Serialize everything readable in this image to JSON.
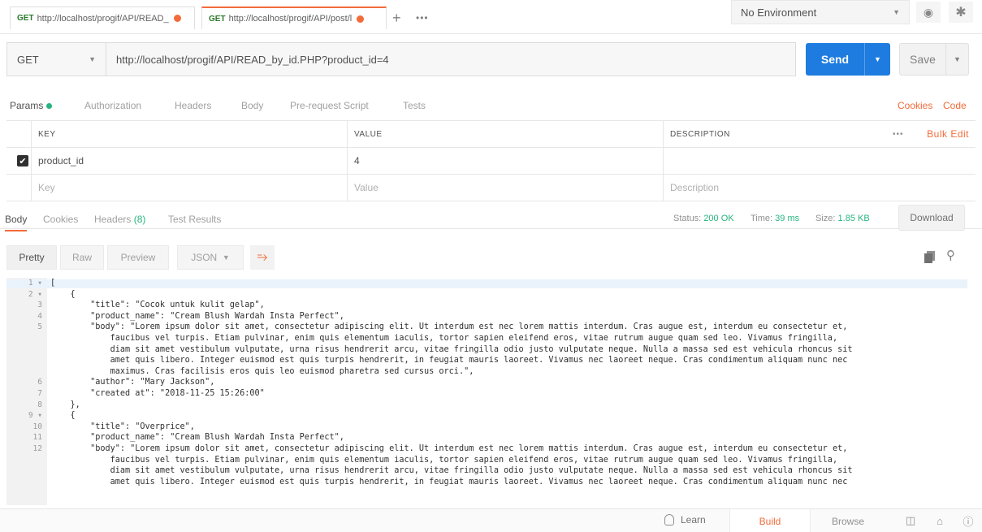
{
  "tabs": [
    {
      "method": "GET",
      "url": "http://localhost/progif/API/READ_"
    },
    {
      "method": "GET",
      "url": "http://localhost/progif/API/post/l"
    }
  ],
  "tabbar": {
    "plus": "+",
    "more": "•••"
  },
  "environment": {
    "selected": "No Environment"
  },
  "request": {
    "method": "GET",
    "url": "http://localhost/progif/API/READ_by_id.PHP?product_id=4",
    "send_label": "Send",
    "save_label": "Save"
  },
  "request_tabs": [
    "Params",
    "Authorization",
    "Headers",
    "Body",
    "Pre-request Script",
    "Tests"
  ],
  "request_links": {
    "cookies": "Cookies",
    "code": "Code"
  },
  "params": {
    "headers": {
      "key": "KEY",
      "value": "VALUE",
      "description": "DESCRIPTION",
      "more": "•••",
      "bulk_edit": "Bulk Edit"
    },
    "rows": [
      {
        "checked": true,
        "key": "product_id",
        "value": "4",
        "description": ""
      }
    ],
    "placeholders": {
      "key": "Key",
      "value": "Value",
      "description": "Description"
    }
  },
  "response_tabs": {
    "body": "Body",
    "cookies": "Cookies",
    "headers": "Headers",
    "headers_count": "(8)",
    "test_results": "Test Results"
  },
  "response_status": {
    "status_label": "Status:",
    "status_value": "200 OK",
    "time_label": "Time:",
    "time_value": "39 ms",
    "size_label": "Size:",
    "size_value": "1.85 KB",
    "download": "Download"
  },
  "format": {
    "pretty": "Pretty",
    "raw": "Raw",
    "preview": "Preview",
    "type": "JSON"
  },
  "code_lines": [
    {
      "n": "1 ▾",
      "t": "["
    },
    {
      "n": "2 ▾",
      "t": "    {"
    },
    {
      "n": "3",
      "t": "        \"title\": \"Cocok untuk kulit gelap\","
    },
    {
      "n": "4",
      "t": "        \"product_name\": \"Cream Blush Wardah Insta Perfect\","
    },
    {
      "n": "5",
      "t": "        \"body\": \"Lorem ipsum dolor sit amet, consectetur adipiscing elit. Ut interdum est nec lorem mattis interdum. Cras augue est, interdum eu consectetur et,"
    },
    {
      "n": "",
      "t": "            faucibus vel turpis. Etiam pulvinar, enim quis elementum iaculis, tortor sapien eleifend eros, vitae rutrum augue quam sed leo. Vivamus fringilla,"
    },
    {
      "n": "",
      "t": "            diam sit amet vestibulum vulputate, urna risus hendrerit arcu, vitae fringilla odio justo vulputate neque. Nulla a massa sed est vehicula rhoncus sit"
    },
    {
      "n": "",
      "t": "            amet quis libero. Integer euismod est quis turpis hendrerit, in feugiat mauris laoreet. Vivamus nec laoreet neque. Cras condimentum aliquam nunc nec"
    },
    {
      "n": "",
      "t": "            maximus. Cras facilisis eros quis leo euismod pharetra sed cursus orci.\","
    },
    {
      "n": "6",
      "t": "        \"author\": \"Mary Jackson\","
    },
    {
      "n": "7",
      "t": "        \"created at\": \"2018-11-25 15:26:00\""
    },
    {
      "n": "8",
      "t": "    },"
    },
    {
      "n": "9 ▾",
      "t": "    {"
    },
    {
      "n": "10",
      "t": "        \"title\": \"Overprice\","
    },
    {
      "n": "11",
      "t": "        \"product_name\": \"Cream Blush Wardah Insta Perfect\","
    },
    {
      "n": "12",
      "t": "        \"body\": \"Lorem ipsum dolor sit amet, consectetur adipiscing elit. Ut interdum est nec lorem mattis interdum. Cras augue est, interdum eu consectetur et,"
    },
    {
      "n": "",
      "t": "            faucibus vel turpis. Etiam pulvinar, enim quis elementum iaculis, tortor sapien eleifend eros, vitae rutrum augue quam sed leo. Vivamus fringilla,"
    },
    {
      "n": "",
      "t": "            diam sit amet vestibulum vulputate, urna risus hendrerit arcu, vitae fringilla odio justo vulputate neque. Nulla a massa sed est vehicula rhoncus sit"
    },
    {
      "n": "",
      "t": "            amet quis libero. Integer euismod est quis turpis hendrerit, in feugiat mauris laoreet. Vivamus nec laoreet neque. Cras condimentum aliquam nunc nec"
    }
  ],
  "footer": {
    "learn": "Learn",
    "build": "Build",
    "browse": "Browse"
  },
  "colors": {
    "accent": "#f26b3a",
    "send": "#1e7ce0",
    "success": "#26b47f"
  },
  "icons": [
    "eye-icon",
    "gear-icon",
    "copy-icon",
    "search-icon",
    "wrap-lines-icon",
    "lightbulb-icon",
    "two-pane-icon",
    "runner-icon",
    "help-icon"
  ]
}
